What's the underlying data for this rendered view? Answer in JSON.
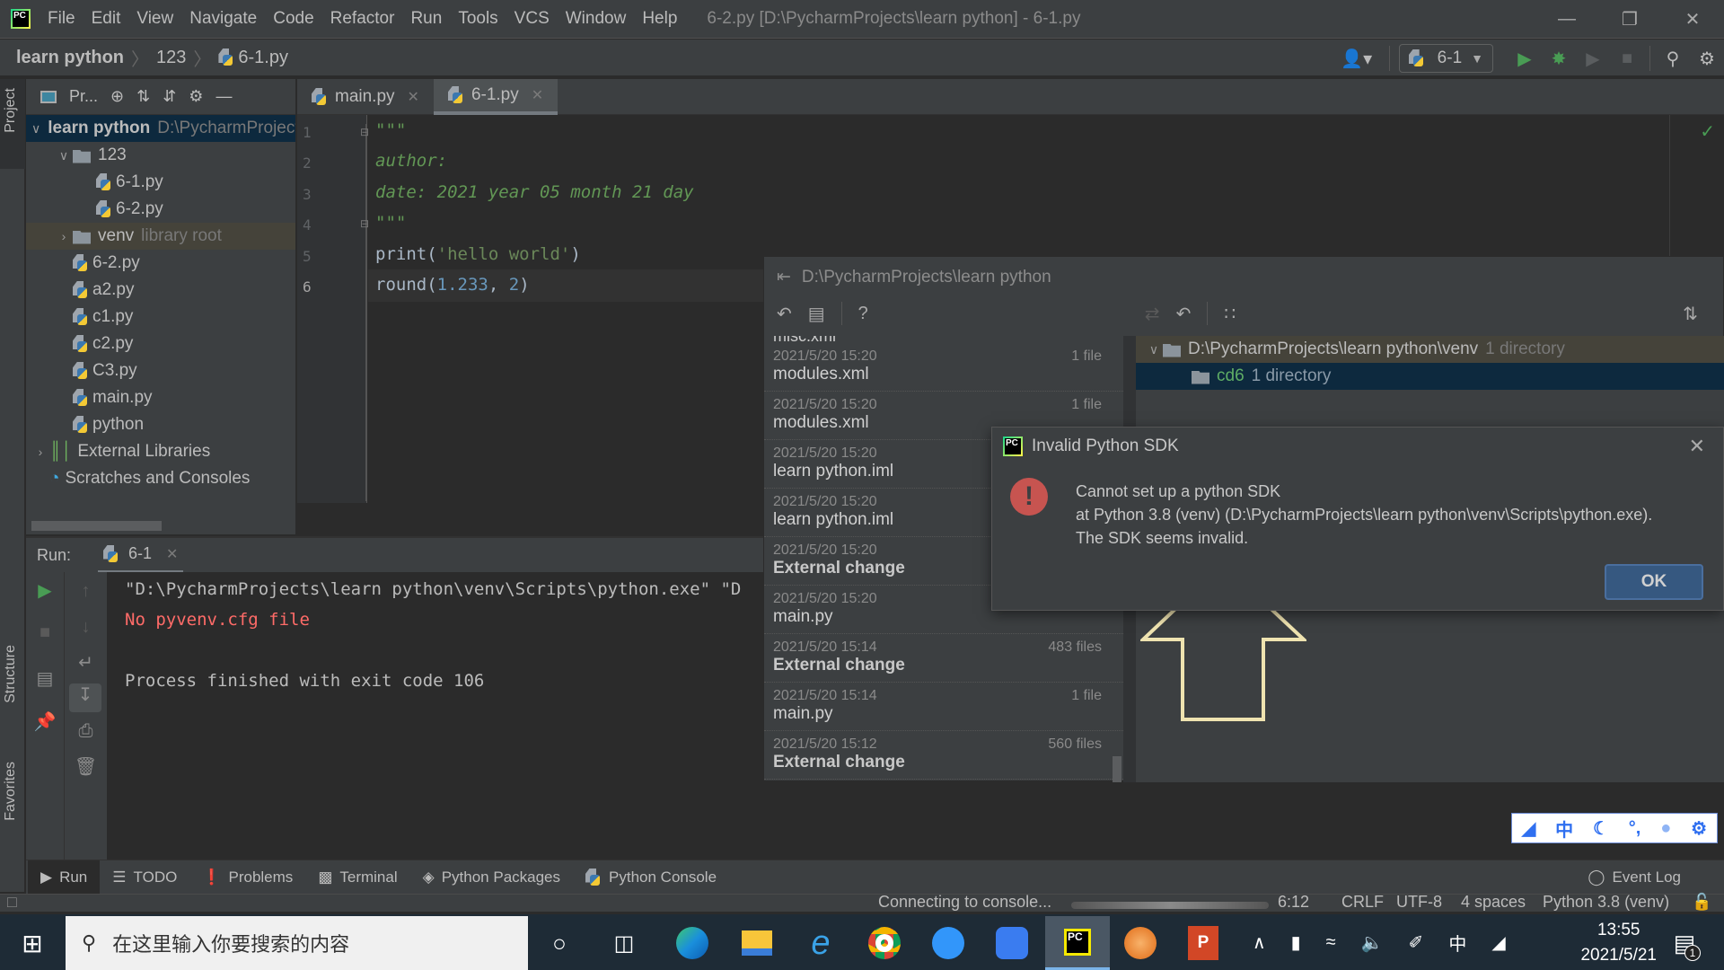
{
  "window": {
    "title": "6-2.py [D:\\PycharmProjects\\learn python] - 6-1.py",
    "menu": [
      "File",
      "Edit",
      "View",
      "Navigate",
      "Code",
      "Refactor",
      "Run",
      "Tools",
      "VCS",
      "Window",
      "Help"
    ]
  },
  "breadcrumb": [
    "learn python",
    "123",
    "6-1.py"
  ],
  "run_config": {
    "name": "6-1"
  },
  "project_panel": {
    "toolbar_label": "Pr...",
    "side_tab": "Project",
    "tree": [
      {
        "label": "learn python",
        "hint": "D:\\PycharmProjects\\learn python",
        "type": "folder",
        "expanded": true,
        "depth": 0
      },
      {
        "label": "123",
        "type": "folder",
        "expanded": true,
        "depth": 1
      },
      {
        "label": "6-1.py",
        "type": "py",
        "depth": 2
      },
      {
        "label": "6-2.py",
        "type": "py",
        "depth": 2
      },
      {
        "label": "venv",
        "hint": "library root",
        "type": "folder",
        "expanded": false,
        "depth": 1
      },
      {
        "label": "6-2.py",
        "type": "py",
        "depth": 1
      },
      {
        "label": "a2.py",
        "type": "py",
        "depth": 1
      },
      {
        "label": "c1.py",
        "type": "py",
        "depth": 1
      },
      {
        "label": "c2.py",
        "type": "py",
        "depth": 1
      },
      {
        "label": "C3.py",
        "type": "py",
        "depth": 1
      },
      {
        "label": "main.py",
        "type": "py",
        "depth": 1
      },
      {
        "label": "python",
        "type": "unknown",
        "depth": 1
      },
      {
        "label": "External Libraries",
        "type": "lib",
        "depth": 0
      },
      {
        "label": "Scratches and Consoles",
        "type": "scratch",
        "depth": 0
      }
    ]
  },
  "editor": {
    "tabs": [
      {
        "label": "main.py",
        "active": false
      },
      {
        "label": "6-1.py",
        "active": true
      }
    ],
    "lines": [
      {
        "n": "1",
        "text": "\"\"\""
      },
      {
        "n": "2",
        "text": "author:"
      },
      {
        "n": "3",
        "text": "date: 2021 year 05 month 21 day"
      },
      {
        "n": "4",
        "text": "\"\"\""
      },
      {
        "n": "5",
        "fn": "print(",
        "str": "'hello world'",
        "end": ")"
      },
      {
        "n": "6",
        "fn": "round(",
        "num1": "1.233",
        "mid": ", ",
        "num2": "2",
        "end": ")"
      }
    ]
  },
  "run_panel": {
    "label": "Run:",
    "tab": "6-1",
    "output": [
      {
        "text": "\"D:\\PycharmProjects\\learn python\\venv\\Scripts\\python.exe\" \"D",
        "error": false
      },
      {
        "text": "No pyvenv.cfg file",
        "error": true
      },
      {
        "text": "",
        "error": false
      },
      {
        "text": "Process finished with exit code 106",
        "error": false
      }
    ]
  },
  "local_history": {
    "title": "D:\\PycharmProjects\\learn python",
    "partial_top": "misc.xml",
    "items": [
      {
        "date": "2021/5/20 15:20",
        "count": "1 file",
        "name": "modules.xml",
        "bold": false
      },
      {
        "date": "2021/5/20 15:20",
        "count": "1 file",
        "name": "modules.xml",
        "bold": false
      },
      {
        "date": "2021/5/20 15:20",
        "count": "",
        "name": "learn python.iml",
        "bold": false
      },
      {
        "date": "2021/5/20 15:20",
        "count": "",
        "name": "learn python.iml",
        "bold": false
      },
      {
        "date": "2021/5/20 15:20",
        "count": "",
        "name": "External change",
        "bold": true
      },
      {
        "date": "2021/5/20 15:20",
        "count": "",
        "name": "main.py",
        "bold": false
      },
      {
        "date": "2021/5/20 15:14",
        "count": "483 files",
        "name": "External change",
        "bold": true
      },
      {
        "date": "2021/5/20 15:14",
        "count": "1 file",
        "name": "main.py",
        "bold": false
      },
      {
        "date": "2021/5/20 15:12",
        "count": "560 files",
        "name": "External change",
        "bold": true
      }
    ],
    "tree": [
      {
        "label": "D:\\PycharmProjects\\learn python\\venv",
        "hint": "1 directory"
      },
      {
        "label": "cd6",
        "hint": "1 directory"
      }
    ]
  },
  "dialog": {
    "title": "Invalid Python SDK",
    "line1": "Cannot set up a python SDK",
    "line2": "at Python 3.8 (venv) (D:\\PycharmProjects\\learn python\\venv\\Scripts\\python.exe).",
    "line3": "The SDK seems invalid.",
    "ok": "OK"
  },
  "bottom_tabs": [
    "Run",
    "TODO",
    "Problems",
    "Terminal",
    "Python Packages",
    "Python Console"
  ],
  "event_log": "Event Log",
  "side_tabs": {
    "structure": "Structure",
    "favorites": "Favorites"
  },
  "status": {
    "message": "Connecting to console...",
    "position": "6:12",
    "line_sep": "CRLF",
    "encoding": "UTF-8",
    "indent": "4 spaces",
    "interpreter": "Python 3.8 (venv)"
  },
  "taskbar": {
    "search_placeholder": "在这里输入你要搜索的内容",
    "ime": "中",
    "time": "13:55",
    "date": "2021/5/21",
    "notifications": "1"
  },
  "colors": {
    "accent": "#365880",
    "error": "#c75450",
    "run_green": "#499c54",
    "docstring": "#629755",
    "arrow": "#efe3b0"
  }
}
